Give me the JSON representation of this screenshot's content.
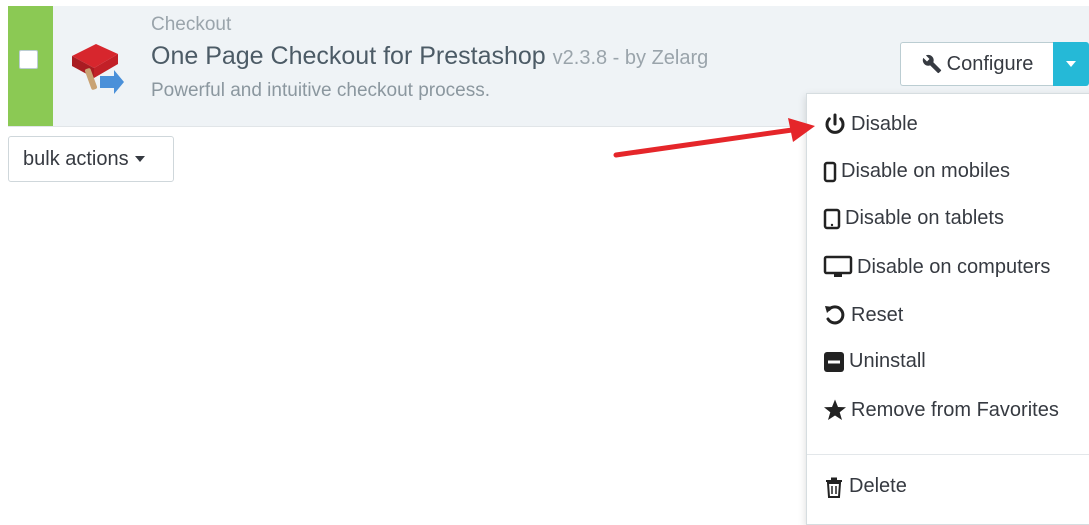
{
  "module": {
    "category": "Checkout",
    "title": "One Page Checkout for Prestashop",
    "version_by": "v2.3.8 - by Zelarg",
    "description": "Powerful and intuitive checkout process.",
    "status_color": "#8bc954"
  },
  "actions": {
    "configure_label": "Configure",
    "accent_color": "#25b9d7"
  },
  "bulk": {
    "label": "bulk actions"
  },
  "dropdown": {
    "items": [
      {
        "label": "Disable",
        "icon": "power-icon"
      },
      {
        "label": "Disable on mobiles",
        "icon": "mobile-icon"
      },
      {
        "label": "Disable on tablets",
        "icon": "tablet-icon"
      },
      {
        "label": "Disable on computers",
        "icon": "desktop-icon"
      },
      {
        "label": "Reset",
        "icon": "reset-icon"
      },
      {
        "label": "Uninstall",
        "icon": "minus-square-icon"
      },
      {
        "label": "Remove from Favorites",
        "icon": "star-icon"
      },
      {
        "label": "Delete",
        "icon": "trash-icon"
      }
    ]
  },
  "annotation": {
    "color": "#e5262a",
    "icon": "red-arrow"
  }
}
